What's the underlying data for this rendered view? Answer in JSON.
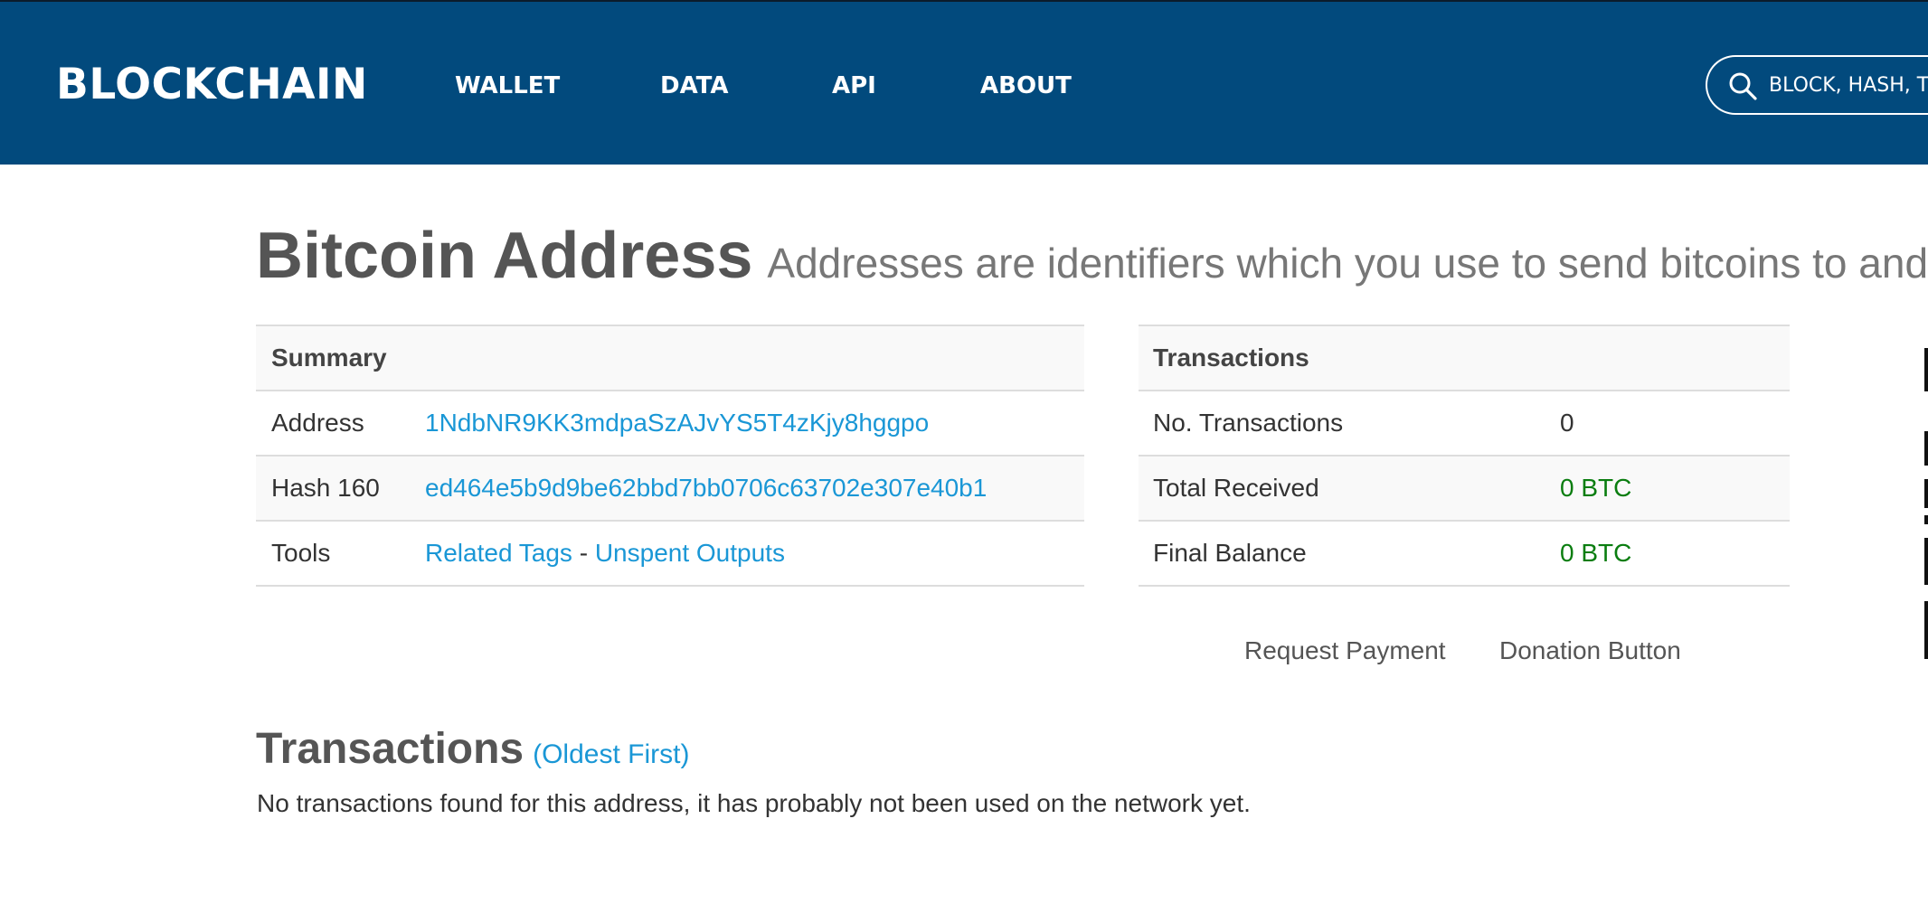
{
  "header": {
    "logo": "BLOCKCHAIN",
    "nav": [
      "WALLET",
      "DATA",
      "API",
      "ABOUT"
    ],
    "search": {
      "placeholder": "BLOCK, HASH, TR"
    }
  },
  "page": {
    "title": "Bitcoin Address",
    "subtitle": "Addresses are identifiers which you use to send bitcoins to and"
  },
  "summary": {
    "heading": "Summary",
    "address_label": "Address",
    "address_value": "1NdbNR9KK3mdpaSzAJvYS5T4zKjy8hggpo",
    "hash_label": "Hash 160",
    "hash_value": "ed464e5b9d9be62bbd7bb0706c63702e307e40b1",
    "tools_label": "Tools",
    "tools_related": "Related Tags",
    "tools_sep": "-",
    "tools_unspent": "Unspent Outputs"
  },
  "transactions_table": {
    "heading": "Transactions",
    "rows": [
      {
        "label": "No. Transactions",
        "value": "0"
      },
      {
        "label": "Total Received",
        "value": "0 BTC"
      },
      {
        "label": "Final Balance",
        "value": "0 BTC"
      }
    ]
  },
  "actions": {
    "request_payment": "Request Payment",
    "donation_button": "Donation Button"
  },
  "transactions_section": {
    "heading": "Transactions",
    "sort_link": "(Oldest First)",
    "empty_message": "No transactions found for this address, it has probably not been used on the network yet."
  },
  "colors": {
    "header_bg": "#024a7d",
    "link": "#1a97d6",
    "btc_value": "#0a7d10"
  }
}
